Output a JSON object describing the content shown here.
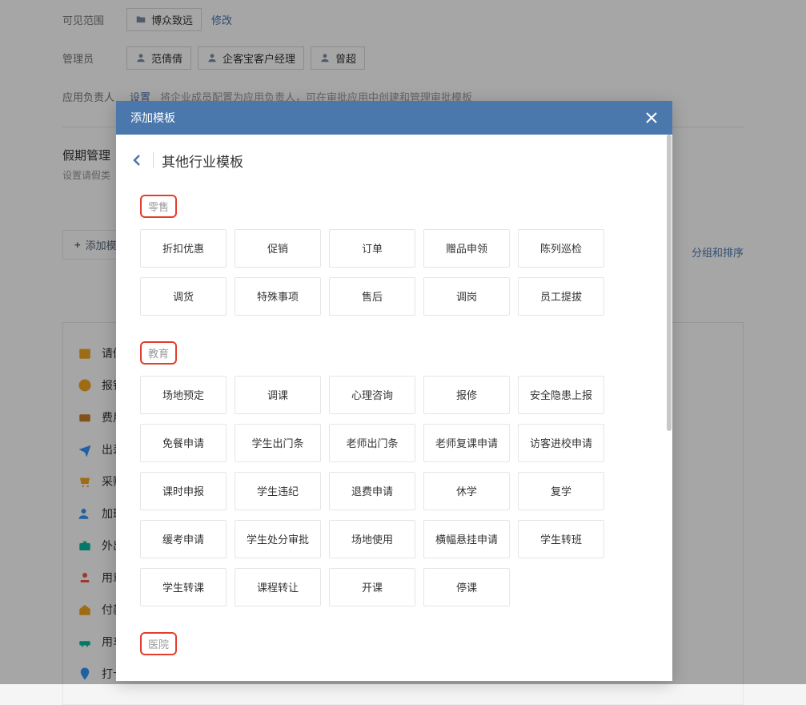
{
  "bg": {
    "rows": {
      "scope": {
        "label": "可见范围",
        "tag": "博众致远",
        "link": "修改"
      },
      "admins": {
        "label": "管理员",
        "tag1": "范倩倩",
        "tag2": "企客宝客户经理",
        "tag3": "曾超"
      },
      "owner": {
        "label": "应用负责人",
        "link": "设置",
        "hint": "将企业成员配置为应用负责人，可在审批应用中创建和管理审批模板"
      }
    },
    "section": {
      "title": "假期管理",
      "sub": "设置请假类"
    },
    "add_btn": "添加模板",
    "right_link": "分组和排序",
    "templates": [
      {
        "name": "请假",
        "color": "c-orange",
        "icon": "calendar"
      },
      {
        "name": "报销",
        "color": "c-orange",
        "icon": "yen"
      },
      {
        "name": "费用",
        "color": "c-brown",
        "icon": "wallet"
      },
      {
        "name": "出差",
        "color": "c-blue",
        "icon": "plane"
      },
      {
        "name": "采购",
        "color": "c-orange",
        "icon": "cart"
      },
      {
        "name": "加班",
        "color": "c-blue",
        "icon": "person-plus"
      },
      {
        "name": "外出",
        "color": "c-cyan",
        "icon": "briefcase"
      },
      {
        "name": "用章",
        "color": "c-red",
        "icon": "stamp"
      },
      {
        "name": "付款",
        "color": "c-orange",
        "icon": "house-yen"
      },
      {
        "name": "用车",
        "color": "c-cyan",
        "icon": "car"
      },
      {
        "name": "打卡补卡",
        "color": "c-blue",
        "icon": "location"
      }
    ]
  },
  "modal": {
    "header": "添加模板",
    "title": "其他行业模板",
    "categories": [
      {
        "name": "零售",
        "highlight": true,
        "items": [
          "折扣优惠",
          "促销",
          "订单",
          "赠品申领",
          "陈列巡检",
          "调货",
          "特殊事项",
          "售后",
          "调岗",
          "员工提拔"
        ]
      },
      {
        "name": "教育",
        "highlight": true,
        "items": [
          "场地预定",
          "调课",
          "心理咨询",
          "报修",
          "安全隐患上报",
          "免餐申请",
          "学生出门条",
          "老师出门条",
          "老师复课申请",
          "访客进校申请",
          "课时申报",
          "学生违纪",
          "退费申请",
          "休学",
          "复学",
          "缓考申请",
          "学生处分审批",
          "场地使用",
          "横幅悬挂申请",
          "学生转班",
          "学生转课",
          "课程转让",
          "开课",
          "停课"
        ]
      },
      {
        "name": "医院",
        "highlight": true,
        "items": []
      }
    ]
  }
}
